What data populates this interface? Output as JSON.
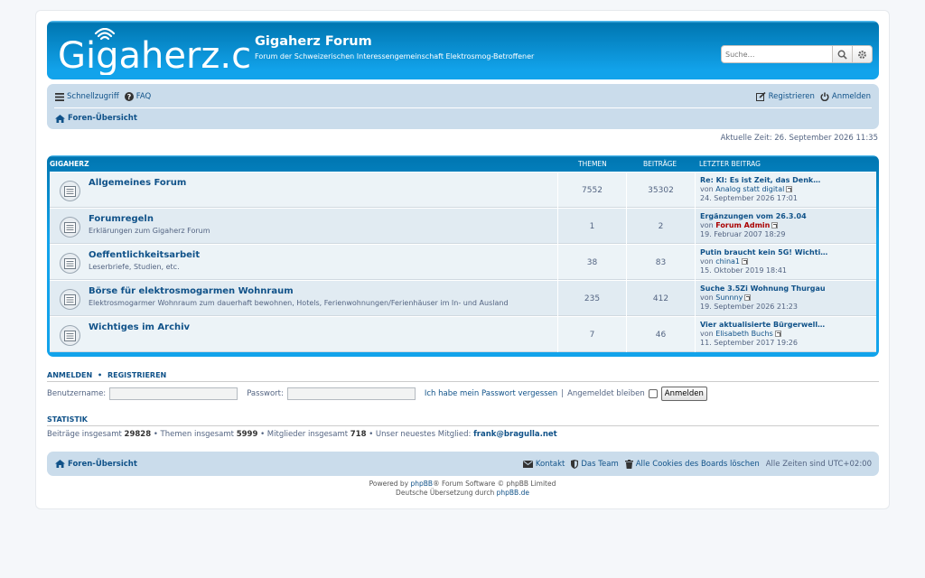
{
  "header": {
    "logo_text": "Gigaherz.ch",
    "site_title": "Gigaherz Forum",
    "site_description": "Forum der Schweizerischen Interessengemeinschaft Elektrosmog-Betroffener",
    "search_placeholder": "Suche…"
  },
  "nav": {
    "quicklinks": "Schnellzugriff",
    "faq": "FAQ",
    "register": "Registrieren",
    "login": "Anmelden",
    "breadcrumb": "Foren-Übersicht"
  },
  "current_time": "Aktuelle Zeit: 26. September 2026 11:35",
  "forum_table": {
    "category": "GIGAHERZ",
    "col_topics": "THEMEN",
    "col_posts": "BEITRÄGE",
    "col_last": "LETZTER BEITRAG",
    "rows": [
      {
        "title": "Allgemeines Forum",
        "desc": "",
        "topics": "7552",
        "posts": "35302",
        "last_title": "Re: KI: Es ist Zeit, das Denk…",
        "by": "von",
        "last_user": "Analog statt digital",
        "last_date": "24. September 2026 17:01"
      },
      {
        "title": "Forumregeln",
        "desc": "Erklärungen zum Gigaherz Forum",
        "topics": "1",
        "posts": "2",
        "last_title": "Ergänzungen vom 26.3.04",
        "by": "von",
        "last_user": "Forum Admin",
        "last_date": "19. Februar 2007 18:29"
      },
      {
        "title": "Oeffentlichkeitsarbeit",
        "desc": "Leserbriefe, Studien, etc.",
        "topics": "38",
        "posts": "83",
        "last_title": "Putin braucht kein 5G! Wichti…",
        "by": "von",
        "last_user": "china1",
        "last_date": "15. Oktober 2019 18:41"
      },
      {
        "title": "Börse für elektrosmogarmen Wohnraum",
        "desc": "Elektrosmogarmer Wohnraum zum dauerhaft bewohnen, Hotels, Ferienwohnungen/Ferienhäuser im In- und Ausland",
        "topics": "235",
        "posts": "412",
        "last_title": "Suche 3.5Zi Wohnung Thurgau",
        "by": "von",
        "last_user": "Sunnny",
        "last_date": "19. September 2026 21:23"
      },
      {
        "title": "Wichtiges im Archiv",
        "desc": "",
        "topics": "7",
        "posts": "46",
        "last_title": "Vier aktualisierte Bürgerwell…",
        "by": "von",
        "last_user": "Elisabeth Buchs",
        "last_date": "11. September 2017 19:26"
      }
    ]
  },
  "login_section": {
    "heading_login": "ANMELDEN",
    "bullet": "•",
    "heading_register": "REGISTRIEREN",
    "username_label": "Benutzername:",
    "password_label": "Passwort:",
    "forgot": "Ich habe mein Passwort vergessen",
    "separator": "|",
    "remember": "Angemeldet bleiben",
    "submit": "Anmelden"
  },
  "stats": {
    "heading": "STATISTIK",
    "posts_label": "Beiträge insgesamt",
    "posts": "29828",
    "topics_label": "• Themen insgesamt",
    "topics": "5999",
    "members_label": "• Mitglieder insgesamt",
    "members": "718",
    "newest_label": "• Unser neuestes Mitglied:",
    "newest": "frank@bragulla.net"
  },
  "footer": {
    "breadcrumb": "Foren-Übersicht",
    "contact": "Kontakt",
    "team": "Das Team",
    "cookies": "Alle Cookies des Boards löschen",
    "timezone": "Alle Zeiten sind UTC+02:00",
    "powered_prefix": "Powered by",
    "phpbb": "phpBB",
    "powered_suffix": "® Forum Software © phpBB Limited",
    "translation_prefix": "Deutsche Übersetzung durch",
    "translation_link": "phpBB.de"
  },
  "colors": {
    "header_blue": "#12a3eb",
    "nav_bg": "#cadceb",
    "link": "#105289",
    "admin": "#aa0000"
  }
}
